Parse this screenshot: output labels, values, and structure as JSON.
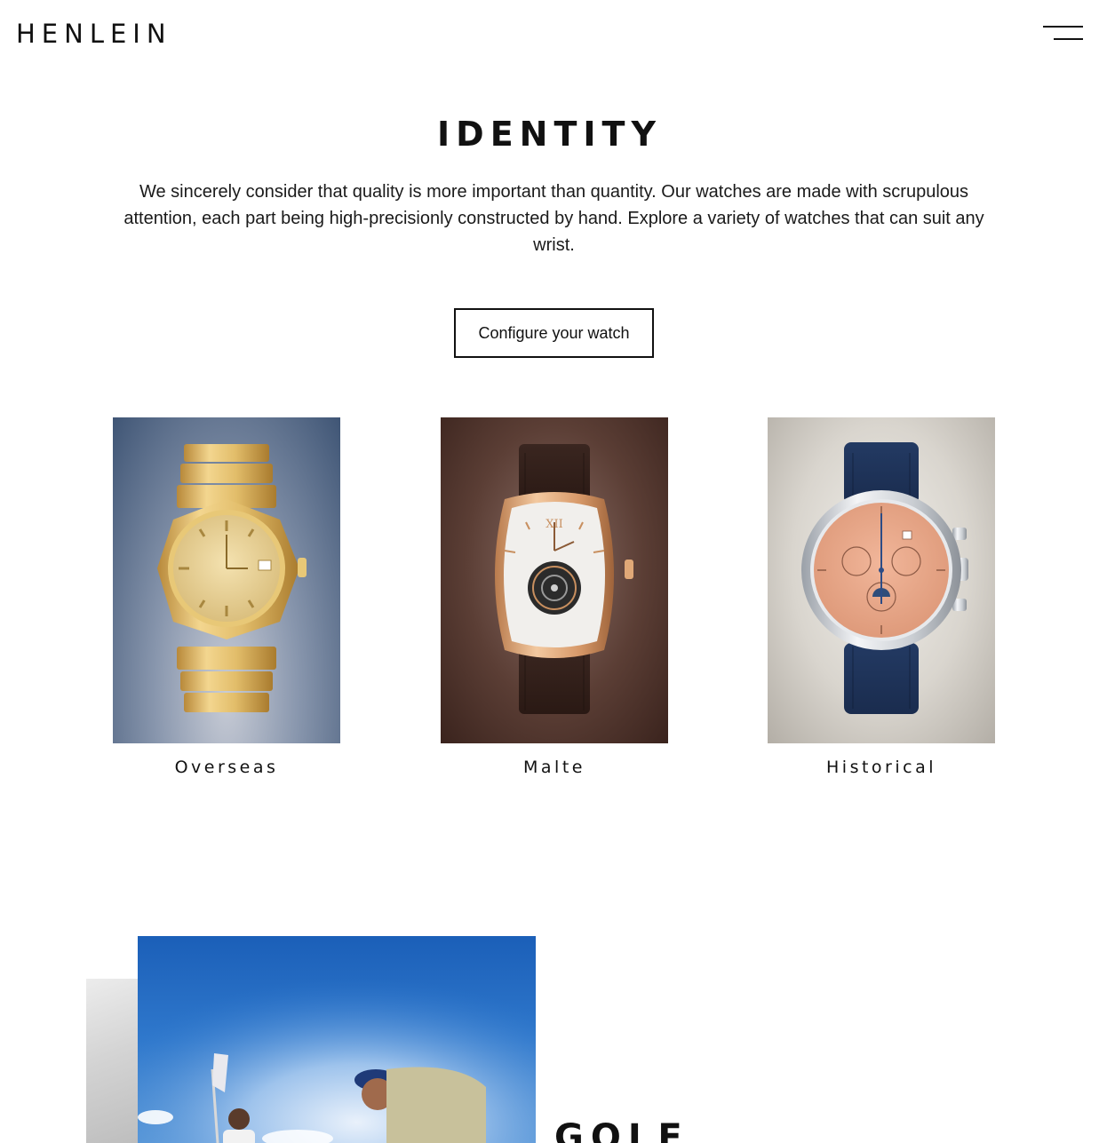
{
  "header": {
    "logo": "HENLEIN",
    "menu_icon": "hamburger-menu-icon"
  },
  "identity": {
    "title": "IDENTITY",
    "description": "We sincerely consider that quality is more important than quantity. Our watches are made with scrupulous attention, each part being high-precisionly constructed by hand. Explore a variety of watches that can suit any wrist.",
    "cta_label": "Configure your watch"
  },
  "collections": [
    {
      "label": "Overseas",
      "image": "gold-bracelet-watch-image"
    },
    {
      "label": "Malte",
      "image": "tonneau-tourbillon-watch-image"
    },
    {
      "label": "Historical",
      "image": "salmon-dial-chronograph-watch-image"
    }
  ],
  "golf": {
    "title": "GOLF",
    "image": "golfers-on-green-photo"
  },
  "colors": {
    "text": "#111111",
    "background": "#ffffff",
    "gold": "#d9b463",
    "sky": "#2f78cc"
  }
}
